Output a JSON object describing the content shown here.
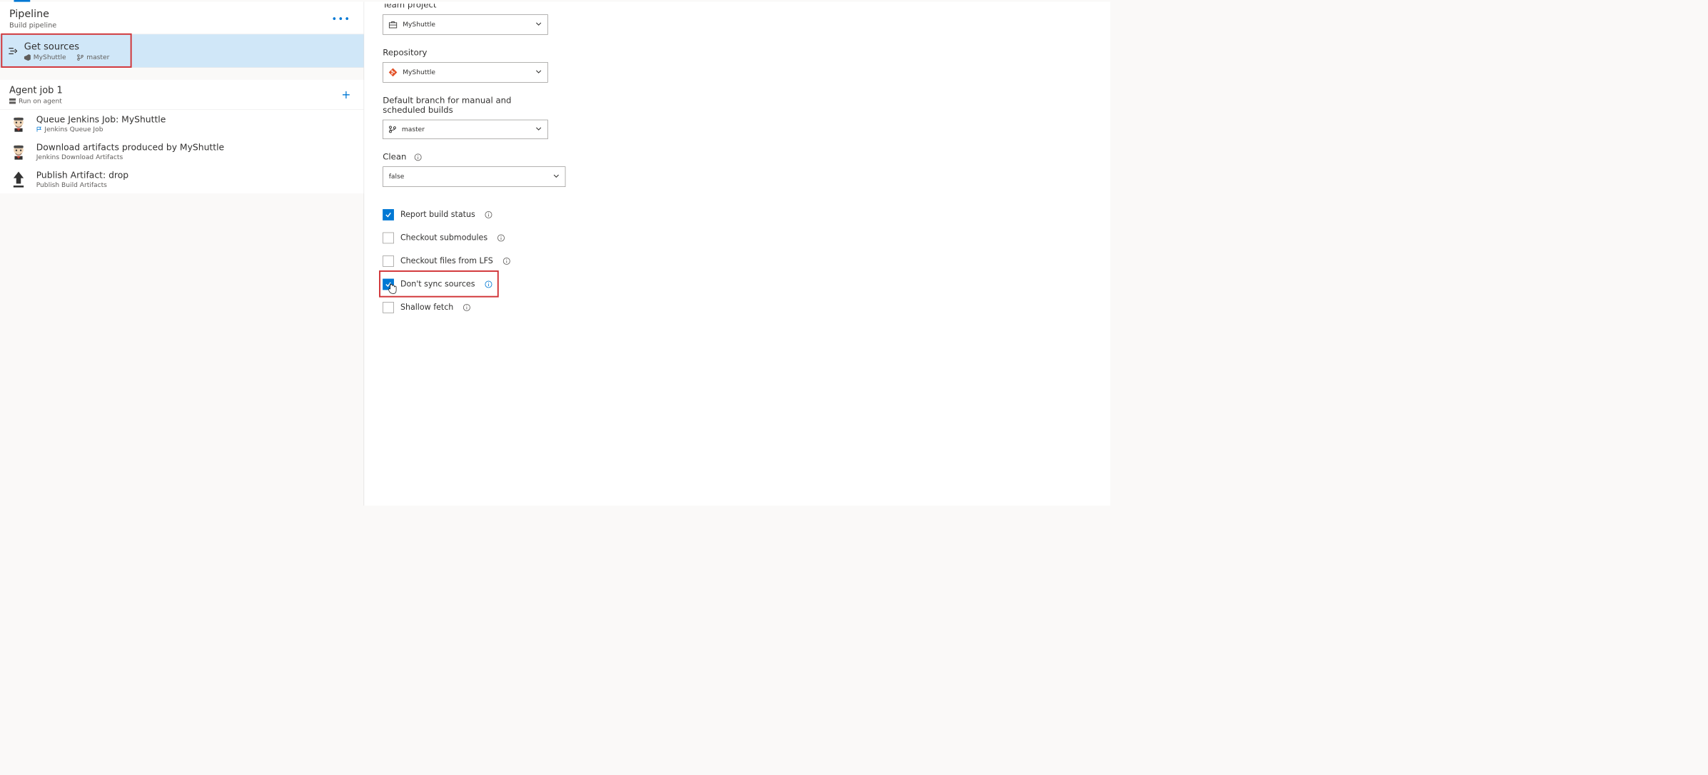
{
  "pipeline": {
    "title": "Pipeline",
    "subtitle": "Build pipeline"
  },
  "getSources": {
    "title": "Get sources",
    "project": "MyShuttle",
    "branch": "master"
  },
  "agentJob": {
    "title": "Agent job 1",
    "subtitle": "Run on agent"
  },
  "tasks": [
    {
      "title": "Queue Jenkins Job: MyShuttle",
      "subtype": "Jenkins Queue Job",
      "icon": "jenkins"
    },
    {
      "title": "Download artifacts produced by MyShuttle",
      "subtype": "Jenkins Download Artifacts",
      "icon": "jenkins"
    },
    {
      "title": "Publish Artifact: drop",
      "subtype": "Publish Build Artifacts",
      "icon": "upload"
    }
  ],
  "form": {
    "teamProject": {
      "label": "Team project",
      "value": "MyShuttle"
    },
    "repository": {
      "label": "Repository",
      "value": "MyShuttle"
    },
    "defaultBranch": {
      "label": "Default branch for manual and scheduled builds",
      "value": "master"
    },
    "clean": {
      "label": "Clean",
      "value": "false"
    }
  },
  "checkboxes": {
    "reportBuildStatus": {
      "label": "Report build status",
      "checked": true
    },
    "checkoutSubmodules": {
      "label": "Checkout submodules",
      "checked": false
    },
    "checkoutLFS": {
      "label": "Checkout files from LFS",
      "checked": false
    },
    "dontSync": {
      "label": "Don't sync sources",
      "checked": true
    },
    "shallowFetch": {
      "label": "Shallow fetch",
      "checked": false
    }
  }
}
